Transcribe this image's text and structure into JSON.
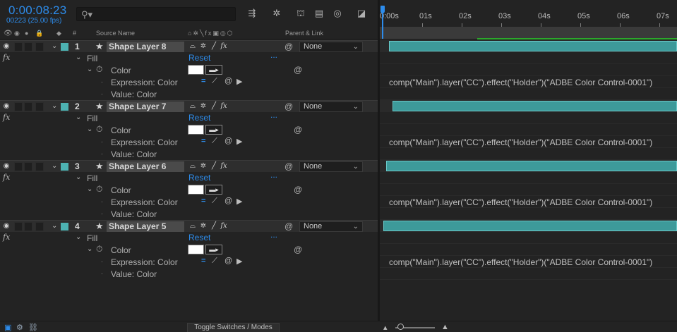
{
  "header": {
    "timecode": "0:00:08:23",
    "frames": "00223 (25.00 fps)",
    "search_placeholder": ""
  },
  "columns": {
    "hash": "#",
    "source_name": "Source Name",
    "parent_link": "Parent & Link"
  },
  "ruler": {
    "ticks": [
      "0:00s",
      "01s",
      "02s",
      "03s",
      "04s",
      "05s",
      "06s",
      "07s"
    ]
  },
  "layers": [
    {
      "number": "1",
      "name": "Shape Layer 8",
      "parent": "None",
      "fill": "Fill",
      "reset": "Reset",
      "dots": "...",
      "color": "Color",
      "expression_label": "Expression: Color",
      "value_label": "Value: Color",
      "expression": "comp(\"Main\").layer(\"CC\").effect(\"Holder\")(\"ADBE Color Control-0001\")",
      "bar_start": 0.02
    },
    {
      "number": "2",
      "name": "Shape Layer 7",
      "parent": "None",
      "fill": "Fill",
      "reset": "Reset",
      "dots": "...",
      "color": "Color",
      "expression_label": "Expression: Color",
      "value_label": "Value: Color",
      "expression": "comp(\"Main\").layer(\"CC\").effect(\"Holder\")(\"ADBE Color Control-0001\")",
      "bar_start": 0.03
    },
    {
      "number": "3",
      "name": "Shape Layer 6",
      "parent": "None",
      "fill": "Fill",
      "reset": "Reset",
      "dots": "...",
      "color": "Color",
      "expression_label": "Expression: Color",
      "value_label": "Value: Color",
      "expression": "comp(\"Main\").layer(\"CC\").effect(\"Holder\")(\"ADBE Color Control-0001\")",
      "bar_start": 0.01
    },
    {
      "number": "4",
      "name": "Shape Layer 5",
      "parent": "None",
      "fill": "Fill",
      "reset": "Reset",
      "dots": "...",
      "color": "Color",
      "expression_label": "Expression: Color",
      "value_label": "Value: Color",
      "expression": "comp(\"Main\").layer(\"CC\").effect(\"Holder\")(\"ADBE Color Control-0001\")",
      "bar_start": 0.0
    }
  ],
  "footer": {
    "toggle_label": "Toggle Switches / Modes"
  },
  "colors": {
    "accent": "#2d8ceb",
    "label_aqua": "#4db3b3",
    "layer_bar": "#3d9a9a",
    "work_area": "#2ba82b"
  }
}
